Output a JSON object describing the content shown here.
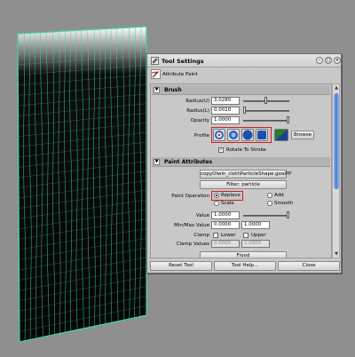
{
  "window": {
    "title": "Tool Settings",
    "controls": {
      "minimize": "–",
      "maximize": "□",
      "close": "×"
    }
  },
  "tool_header": {
    "icon": "attribute-paint-brush-icon",
    "label": "Attribute Paint"
  },
  "brush": {
    "section_label": "Brush",
    "radius_u": {
      "label": "Radius(U)",
      "value": "3.0280"
    },
    "radius_l": {
      "label": "Radius(L)",
      "value": "0.0010"
    },
    "opacity": {
      "label": "Opacity",
      "value": "1.0000"
    },
    "profile": {
      "label": "Profile",
      "browse_label": "Browse"
    },
    "rotate_to_stroke": {
      "label": "Rotate To Stroke",
      "checked": true
    }
  },
  "paint_attributes": {
    "section_label": "Paint Attributes",
    "attribute_button": "copyOlwin_clothParticleShape.goalPP",
    "filter_button": "Filter: particle",
    "paint_operation": {
      "label": "Paint Operation",
      "options": [
        "Replace",
        "Add",
        "Scale",
        "Smooth"
      ],
      "selected": "Replace"
    },
    "value": {
      "label": "Value",
      "value": "1.0000"
    },
    "min_max": {
      "label": "Min/Max Value",
      "min": "0.0000",
      "max": "1.0000"
    },
    "clamp": {
      "label": "Clamp",
      "lower": "Lower",
      "upper": "Upper"
    },
    "clamp_values": {
      "label": "Clamp Values",
      "min": "0.0000",
      "max": "1.0000"
    },
    "flood_button": "Flood"
  },
  "footer": {
    "reset": "Reset Tool",
    "help": "Tool Help...",
    "close": "Close"
  },
  "colors": {
    "mesh": "#3dd6a0",
    "scroll_thumb": "#4d7fd0",
    "highlight": "#d41c1c"
  }
}
